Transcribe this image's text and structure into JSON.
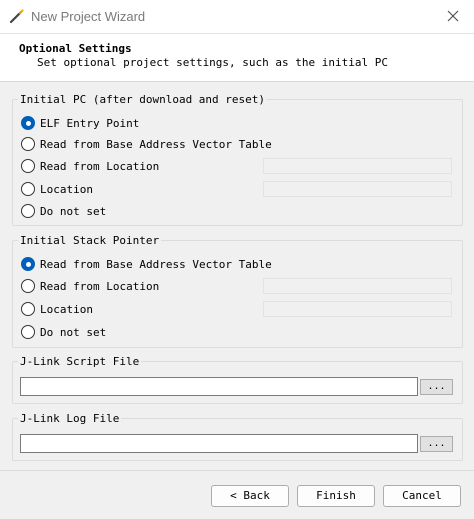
{
  "window": {
    "title": "New Project Wizard",
    "icon": "wand-icon",
    "close_icon": "close-icon"
  },
  "header": {
    "title": "Optional Settings",
    "description": "Set optional project settings, such as the initial PC"
  },
  "initial_pc": {
    "legend": "Initial PC (after download and reset)",
    "selected": "ELF Entry Point",
    "options": [
      {
        "label": "ELF Entry Point",
        "checked": true,
        "input_value": null
      },
      {
        "label": "Read from Base Address Vector Table",
        "checked": false,
        "input_value": null
      },
      {
        "label": "Read from Location",
        "checked": false,
        "input_value": ""
      },
      {
        "label": "Location",
        "checked": false,
        "input_value": ""
      },
      {
        "label": "Do not set",
        "checked": false,
        "input_value": null
      }
    ]
  },
  "initial_sp": {
    "legend": "Initial Stack Pointer",
    "selected": "Read from Base Address Vector Table",
    "options": [
      {
        "label": "Read from Base Address Vector Table",
        "checked": true,
        "input_value": null
      },
      {
        "label": "Read from Location",
        "checked": false,
        "input_value": ""
      },
      {
        "label": "Location",
        "checked": false,
        "input_value": ""
      },
      {
        "label": "Do not set",
        "checked": false,
        "input_value": null
      }
    ]
  },
  "jlink_script": {
    "legend": "J-Link Script File",
    "value": "",
    "browse_label": "..."
  },
  "jlink_log": {
    "legend": "J-Link Log File",
    "value": "",
    "browse_label": "..."
  },
  "buttons": {
    "back": "< Back",
    "finish": "Finish",
    "cancel": "Cancel"
  },
  "colors": {
    "accent": "#005fb8",
    "background": "#f0f0f0"
  }
}
